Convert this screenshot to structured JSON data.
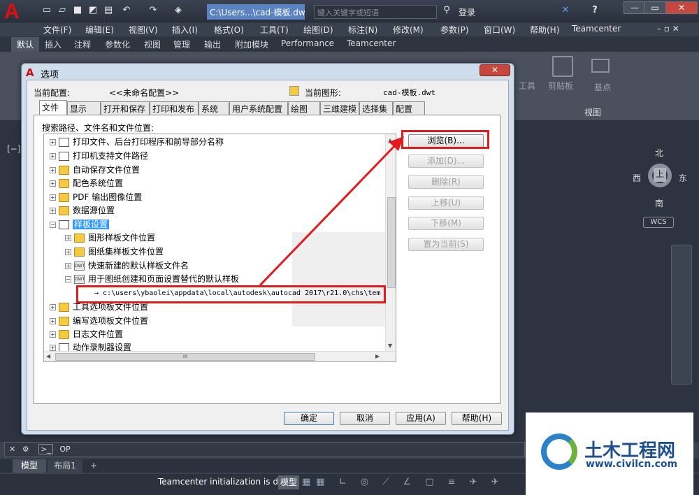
{
  "app": {
    "logo": "A",
    "doc_tab": "C:\\Users...\\cad-模板.dwt",
    "search_placeholder": "键入关键字或短语",
    "login": "登录"
  },
  "menubar": [
    "文件(F)",
    "编辑(E)",
    "视图(V)",
    "插入(I)",
    "格式(O)",
    "工具(T)",
    "绘图(D)",
    "标注(N)",
    "修改(M)",
    "参数(P)",
    "窗口(W)",
    "帮助(H)",
    "Teamcenter"
  ],
  "ribbon_tabs": [
    "默认",
    "插入",
    "注释",
    "参数化",
    "视图",
    "管理",
    "输出",
    "附加模块",
    "Performance",
    "Teamcenter"
  ],
  "ribbon": {
    "clipboard": "剪贴板",
    "tools": "工具",
    "base": "基点",
    "view": "视图"
  },
  "canvas": {
    "viewport": "[−]",
    "north": "北",
    "south": "南",
    "east": "东",
    "west": "西",
    "top": "上",
    "wcs": "WCS"
  },
  "dialog": {
    "title": "选项",
    "current_profile_label": "当前配置:",
    "current_profile": "<<未命名配置>>",
    "current_drawing_label": "当前图形:",
    "current_drawing": "cad-模板.dwt",
    "tabs": [
      "文件",
      "显示",
      "打开和保存",
      "打印和发布",
      "系统",
      "用户系统配置",
      "绘图",
      "三维建模",
      "选择集",
      "配置"
    ],
    "tree_label": "搜索路径、文件名和文件位置:",
    "tree": {
      "print_files": "打印文件、后台打印程序和前导部分名称",
      "printer_support": "打印机支持文件路径",
      "autosave": "自动保存文件位置",
      "color_books": "配色系统位置",
      "pdf": "PDF 输出图像位置",
      "data_sources": "数据源位置",
      "template": "样板设置",
      "drawing_template": "图形样板文件位置",
      "sheet_set_template": "图纸集样板文件位置",
      "qnew_template": "快速新建的默认样板文件名",
      "default_template_override": "用于图纸创建和页面设置替代的默认样板",
      "template_path": "c:\\users\\ybaolei\\appdata\\local\\autodesk\\autocad 2017\\r21.0\\chs\\tem",
      "tool_palettes": "工具选项板文件位置",
      "authoring_palettes": "编写选项板文件位置",
      "log_files": "日志文件位置",
      "action_recorder": "动作录制器设置",
      "hscroll_grip": "III"
    },
    "side_buttons": {
      "browse": "浏览(B)...",
      "add": "添加(D)...",
      "remove": "删除(R)",
      "move_up": "上移(U)",
      "move_down": "下移(M)",
      "set_current": "置为当前(S)"
    },
    "bottom_buttons": {
      "ok": "确定",
      "cancel": "取消",
      "apply": "应用(A)",
      "help": "帮助(H)"
    }
  },
  "command": {
    "prompt": "OP"
  },
  "layout_tabs": [
    "模型",
    "布局1",
    "+"
  ],
  "status": {
    "message": "Teamcenter initialization is done",
    "model": "模型"
  },
  "watermark": {
    "brand": "土木工程网",
    "url": "www.civilcn.com"
  }
}
